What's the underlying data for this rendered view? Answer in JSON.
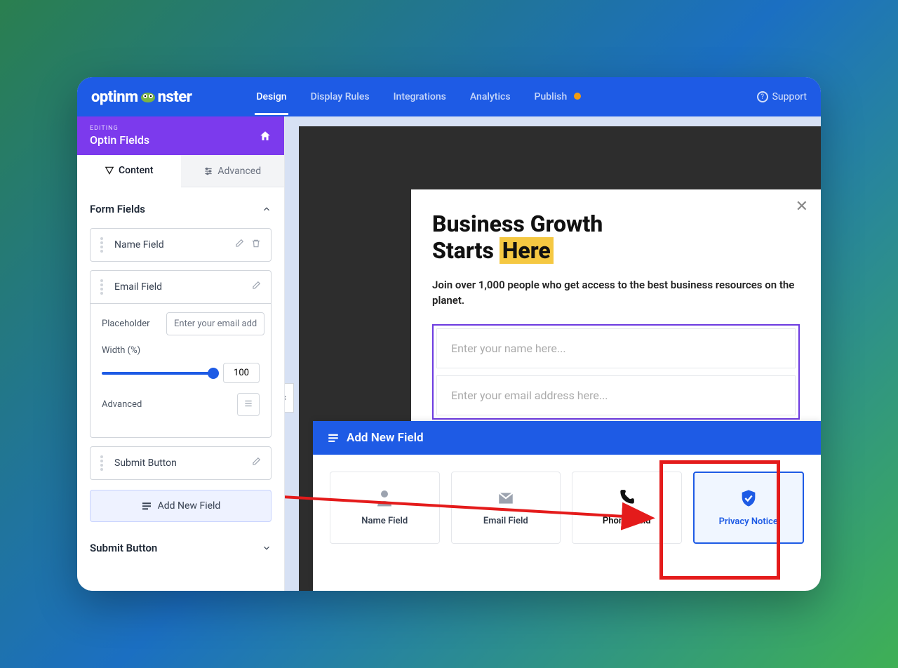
{
  "brand": "optinm nster",
  "nav": {
    "tabs": [
      "Design",
      "Display Rules",
      "Integrations",
      "Analytics",
      "Publish"
    ],
    "active": "Design",
    "support": "Support"
  },
  "sidebar": {
    "editing_label": "EDITING",
    "editing_title": "Optin Fields",
    "sub_tabs": {
      "content": "Content",
      "advanced": "Advanced"
    },
    "sections": {
      "form_fields": "Form Fields",
      "submit_button_section": "Submit Button"
    },
    "fields": {
      "name": "Name Field",
      "email": "Email Field",
      "submit": "Submit Button"
    },
    "email_settings": {
      "placeholder_label": "Placeholder",
      "placeholder_value": "Enter your email add",
      "width_label": "Width (%)",
      "width_value": "100",
      "advanced_label": "Advanced"
    },
    "add_field_btn": "Add New Field"
  },
  "popup": {
    "title_line1": "Business Growth",
    "title_line2a": "Starts ",
    "title_line2b": "Here",
    "subtitle": "Join over 1,000 people who get access to the best business resources on the planet.",
    "input_name": "Enter your name here...",
    "input_email": "Enter your email address here..."
  },
  "field_panel": {
    "title": "Add New Field",
    "options": {
      "name": "Name Field",
      "email": "Email Field",
      "phone": "Phone Field",
      "privacy": "Privacy Notice"
    }
  }
}
